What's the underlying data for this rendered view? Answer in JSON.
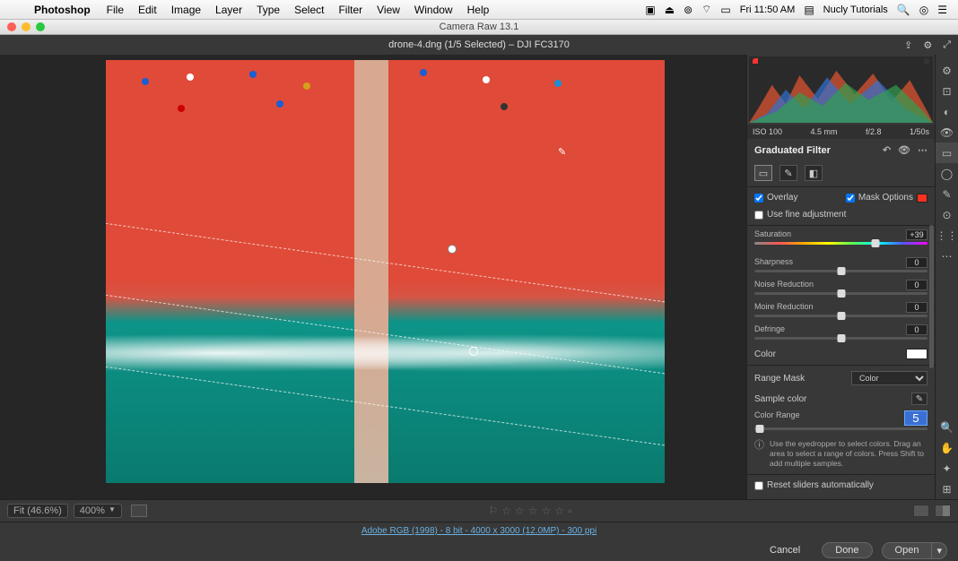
{
  "menubar": {
    "app": "Photoshop",
    "items": [
      "File",
      "Edit",
      "Image",
      "Layer",
      "Type",
      "Select",
      "Filter",
      "View",
      "Window",
      "Help"
    ],
    "clock": "Fri 11:50 AM",
    "user": "Nucly Tutorials"
  },
  "window_title": "Camera Raw 13.1",
  "header": {
    "filename": "drone-4.dng (1/5 Selected)  –  DJI FC3170"
  },
  "exposure": {
    "iso": "ISO 100",
    "focal": "4.5 mm",
    "aperture": "f/2.8",
    "shutter": "1/50s"
  },
  "panel_title": "Graduated Filter",
  "tools": {
    "rect": "▭",
    "brush": "✎",
    "eraser": "◧"
  },
  "overlay": {
    "label": "Overlay",
    "checked": true
  },
  "mask_options": {
    "label": "Mask Options",
    "checked": true
  },
  "fine_adjust": {
    "label": "Use fine adjustment",
    "checked": false
  },
  "sliders": {
    "saturation": {
      "label": "Saturation",
      "value": "+39",
      "pos": 70
    },
    "sharpness": {
      "label": "Sharpness",
      "value": "0",
      "pos": 50
    },
    "noise": {
      "label": "Noise Reduction",
      "value": "0",
      "pos": 50
    },
    "moire": {
      "label": "Moire Reduction",
      "value": "0",
      "pos": 50
    },
    "defringe": {
      "label": "Defringe",
      "value": "0",
      "pos": 50
    }
  },
  "color_label": "Color",
  "range_mask": {
    "label": "Range Mask",
    "selected": "Color"
  },
  "sample_color": {
    "label": "Sample color"
  },
  "color_range": {
    "label": "Color Range",
    "value": "5"
  },
  "hint": "Use the eyedropper to select colors. Drag an area to select a range of colors. Press Shift to add multiple samples.",
  "reset": {
    "label": "Reset sliders automatically",
    "checked": false
  },
  "footer": {
    "fit": "Fit (46.6%)",
    "zoom": "400%",
    "info": "Adobe RGB (1998) - 8 bit - 4000 x 3000 (12.0MP) - 300 ppi",
    "cancel": "Cancel",
    "done": "Done",
    "open": "Open"
  }
}
